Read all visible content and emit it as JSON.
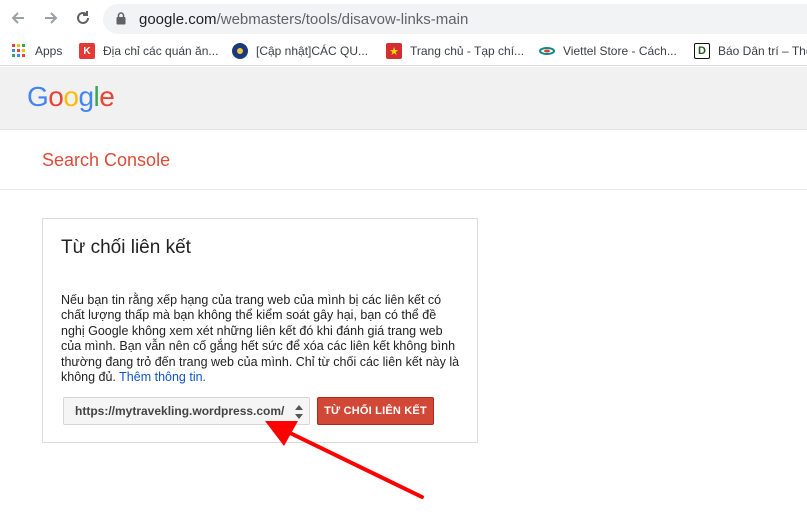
{
  "browser": {
    "url_host": "google.com",
    "url_path": "/webmasters/tools/disavow-links-main",
    "bookmarks": [
      {
        "label": "Apps",
        "icon": "apps-grid-icon"
      },
      {
        "label": "Địa chỉ các quán ăn...",
        "icon": "k-logo-icon"
      },
      {
        "label": "[Cập nhật]CÁC QU...",
        "icon": "globe-badge-icon"
      },
      {
        "label": "Trang chủ - Tạp chí...",
        "icon": "star-flag-icon"
      },
      {
        "label": "Viettel Store - Cách...",
        "icon": "viettel-icon"
      },
      {
        "label": "Báo Dân trí – Thô",
        "icon": "d-logo-icon"
      }
    ]
  },
  "header": {
    "logo": [
      "G",
      "o",
      "o",
      "g",
      "l",
      "e"
    ],
    "logo_colors": [
      "#4285f4",
      "#ea4335",
      "#fbbc05",
      "#4285f4",
      "#34a853",
      "#ea4335"
    ],
    "product": "Search Console"
  },
  "card": {
    "title": "Từ chối liên kết",
    "body": "Nếu bạn tin rằng xếp hạng của trang web của mình bị các liên kết có chất lượng thấp mà bạn không thể kiểm soát gây hại, bạn có thể đề nghị Google không xem xét những liên kết đó khi đánh giá trang web của mình. Bạn vẫn nên cố gắng hết sức để xóa các liên kết không bình thường đang trỏ đến trang web của mình. Chỉ từ chối các liên kết này là không đủ.",
    "link": "Thêm thông tin.",
    "site_select": "https://mytravekling.wordpress.com/",
    "button": "TỪ CHỐI LIÊN KẾT"
  },
  "colors": {
    "accent_red": "#d14836",
    "arrow_red": "#ff0000",
    "link_blue": "#1155cc"
  }
}
